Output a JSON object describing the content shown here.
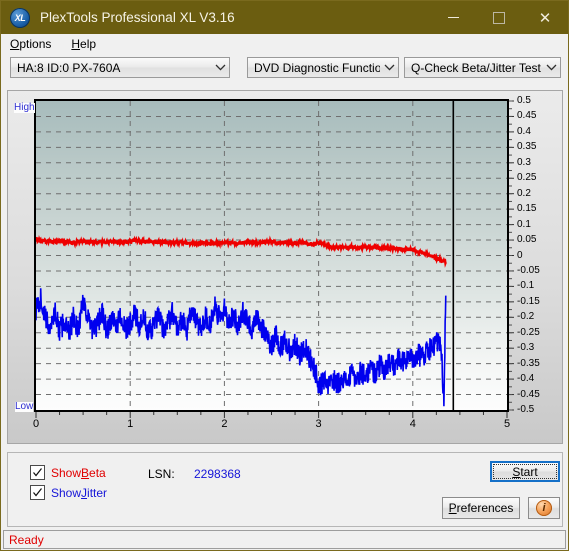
{
  "window": {
    "title": "PlexTools Professional XL V3.16",
    "logo_text": "XL",
    "minimize_icon": "minimize-icon",
    "maximize_icon": "maximize-icon",
    "close_icon": "close-icon",
    "close_glyph": "✕",
    "titlebar_color": "#6b5d10"
  },
  "menubar": {
    "items": [
      {
        "accel": "O",
        "rest": "ptions"
      },
      {
        "accel": "H",
        "rest": "elp"
      }
    ]
  },
  "toolbar": {
    "drive_select": "HA:8 ID:0  PX-760A",
    "function_select": "DVD Diagnostic Functions",
    "test_select": "Q-Check Beta/Jitter Test"
  },
  "chart_panel": {
    "high_label": "High",
    "low_label": "Low"
  },
  "controls": {
    "show_beta": {
      "accel_pre": "Show ",
      "accel": "B",
      "rest": "eta",
      "checked": true,
      "color": "#e00000"
    },
    "show_jitter": {
      "accel_pre": "Show ",
      "accel": "J",
      "rest": "itter",
      "checked": true,
      "color": "#1515d8"
    },
    "lsn_label": "LSN:",
    "lsn_value": "2298368",
    "start_button": {
      "accel": "S",
      "rest": "tart"
    },
    "preferences_button": {
      "accel": "P",
      "rest": "references"
    },
    "info_button": {
      "icon": "info-icon",
      "glyph": "i"
    }
  },
  "statusbar": {
    "text": "Ready"
  },
  "chart_data": {
    "type": "line",
    "title": "Q-Check Beta/Jitter Test",
    "xlabel": "",
    "ylabel": "",
    "xlim": [
      0,
      5
    ],
    "ylim": [
      -0.5,
      0.5
    ],
    "grid": true,
    "legend_position": "bottom-left",
    "x_ticks": [
      0,
      1,
      2,
      3,
      4,
      5
    ],
    "y_ticks": [
      0.5,
      0.45,
      0.4,
      0.35,
      0.3,
      0.25,
      0.2,
      0.15,
      0.1,
      0.05,
      0,
      -0.05,
      -0.1,
      -0.15,
      -0.2,
      -0.25,
      -0.3,
      -0.35,
      -0.4,
      -0.45,
      -0.5
    ],
    "y_tick_labels": [
      "0.5",
      "0.45",
      "0.4",
      "0.35",
      "0.3",
      "0.25",
      "0.2",
      "0.15",
      "0.1",
      "0.05",
      "0",
      "-0.05",
      "-0.1",
      "-0.15",
      "-0.2",
      "-0.25",
      "-0.3",
      "-0.35",
      "-0.4",
      "-0.45",
      "-0.5"
    ],
    "x_tick_labels": [
      "0",
      "1",
      "2",
      "3",
      "4",
      "5"
    ],
    "cursor_x": 4.43,
    "data_end_x": 4.35,
    "series": [
      {
        "name": "Beta",
        "color": "#ee0000",
        "x": [
          0.0,
          0.05,
          0.1,
          0.15,
          0.2,
          0.25,
          0.3,
          0.35,
          0.4,
          0.45,
          0.5,
          0.55,
          0.6,
          0.65,
          0.7,
          0.75,
          0.8,
          0.85,
          0.9,
          0.95,
          1.0,
          1.05,
          1.1,
          1.15,
          1.2,
          1.25,
          1.3,
          1.35,
          1.4,
          1.45,
          1.5,
          1.55,
          1.6,
          1.65,
          1.7,
          1.75,
          1.8,
          1.85,
          1.9,
          1.95,
          2.0,
          2.05,
          2.1,
          2.15,
          2.2,
          2.25,
          2.3,
          2.35,
          2.4,
          2.45,
          2.5,
          2.55,
          2.6,
          2.65,
          2.7,
          2.75,
          2.8,
          2.85,
          2.9,
          2.95,
          3.0,
          3.05,
          3.1,
          3.15,
          3.2,
          3.25,
          3.3,
          3.35,
          3.4,
          3.45,
          3.5,
          3.55,
          3.6,
          3.65,
          3.7,
          3.75,
          3.8,
          3.85,
          3.9,
          3.95,
          4.0,
          4.05,
          4.1,
          4.15,
          4.2,
          4.25,
          4.3,
          4.35
        ],
        "y": [
          0.05,
          0.048,
          0.046,
          0.045,
          0.044,
          0.046,
          0.045,
          0.043,
          0.042,
          0.044,
          0.046,
          0.045,
          0.044,
          0.043,
          0.042,
          0.041,
          0.043,
          0.044,
          0.043,
          0.042,
          0.046,
          0.048,
          0.047,
          0.046,
          0.045,
          0.044,
          0.043,
          0.042,
          0.041,
          0.042,
          0.043,
          0.041,
          0.04,
          0.039,
          0.04,
          0.041,
          0.04,
          0.039,
          0.04,
          0.041,
          0.042,
          0.041,
          0.04,
          0.041,
          0.042,
          0.043,
          0.042,
          0.041,
          0.042,
          0.043,
          0.044,
          0.043,
          0.042,
          0.041,
          0.04,
          0.041,
          0.042,
          0.041,
          0.04,
          0.039,
          0.04,
          0.038,
          0.03,
          0.028,
          0.027,
          0.026,
          0.027,
          0.028,
          0.027,
          0.026,
          0.027,
          0.028,
          0.027,
          0.026,
          0.025,
          0.024,
          0.023,
          0.022,
          0.021,
          0.02,
          0.018,
          0.014,
          0.01,
          0.004,
          -0.002,
          -0.008,
          -0.014,
          -0.022
        ]
      },
      {
        "name": "Jitter",
        "color": "#0000ee",
        "x": [
          0.0,
          0.05,
          0.1,
          0.15,
          0.2,
          0.25,
          0.3,
          0.35,
          0.4,
          0.45,
          0.5,
          0.55,
          0.6,
          0.65,
          0.7,
          0.75,
          0.8,
          0.85,
          0.9,
          0.95,
          1.0,
          1.05,
          1.1,
          1.15,
          1.2,
          1.25,
          1.3,
          1.35,
          1.4,
          1.45,
          1.5,
          1.55,
          1.6,
          1.65,
          1.7,
          1.75,
          1.8,
          1.85,
          1.9,
          1.95,
          2.0,
          2.05,
          2.1,
          2.15,
          2.2,
          2.25,
          2.3,
          2.35,
          2.4,
          2.45,
          2.5,
          2.55,
          2.6,
          2.65,
          2.7,
          2.75,
          2.8,
          2.85,
          2.9,
          2.95,
          3.0,
          3.05,
          3.1,
          3.15,
          3.2,
          3.25,
          3.3,
          3.35,
          3.4,
          3.45,
          3.5,
          3.55,
          3.6,
          3.65,
          3.7,
          3.75,
          3.8,
          3.85,
          3.9,
          3.95,
          4.0,
          4.05,
          4.1,
          4.15,
          4.2,
          4.25,
          4.3,
          4.33,
          4.35
        ],
        "y": [
          -0.175,
          -0.14,
          -0.205,
          -0.235,
          -0.18,
          -0.245,
          -0.215,
          -0.255,
          -0.195,
          -0.245,
          -0.135,
          -0.2,
          -0.25,
          -0.225,
          -0.185,
          -0.245,
          -0.21,
          -0.23,
          -0.19,
          -0.245,
          -0.215,
          -0.19,
          -0.235,
          -0.205,
          -0.25,
          -0.225,
          -0.195,
          -0.24,
          -0.215,
          -0.185,
          -0.23,
          -0.205,
          -0.245,
          -0.18,
          -0.215,
          -0.235,
          -0.195,
          -0.225,
          -0.17,
          -0.205,
          -0.175,
          -0.215,
          -0.19,
          -0.235,
          -0.18,
          -0.21,
          -0.245,
          -0.2,
          -0.235,
          -0.265,
          -0.29,
          -0.255,
          -0.3,
          -0.275,
          -0.31,
          -0.285,
          -0.32,
          -0.295,
          -0.33,
          -0.36,
          -0.42,
          -0.41,
          -0.425,
          -0.4,
          -0.415,
          -0.395,
          -0.41,
          -0.385,
          -0.4,
          -0.375,
          -0.39,
          -0.365,
          -0.38,
          -0.355,
          -0.37,
          -0.345,
          -0.36,
          -0.335,
          -0.35,
          -0.325,
          -0.34,
          -0.315,
          -0.33,
          -0.305,
          -0.3,
          -0.285,
          -0.29,
          -0.47,
          -0.13
        ]
      }
    ]
  }
}
